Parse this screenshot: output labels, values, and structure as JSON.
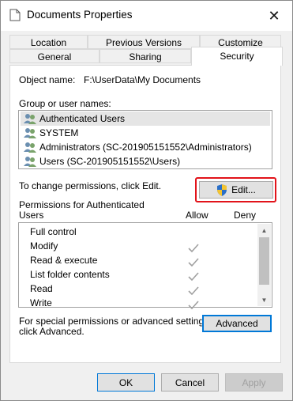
{
  "window": {
    "title": "Documents Properties",
    "close_glyph": "✕"
  },
  "tabs_top": [
    {
      "label": "Location"
    },
    {
      "label": "Previous Versions"
    },
    {
      "label": "Customize"
    }
  ],
  "tabs_bottom": [
    {
      "label": "General"
    },
    {
      "label": "Sharing"
    },
    {
      "label": "Security",
      "active": true
    }
  ],
  "security": {
    "object_label": "Object name:",
    "object_value": "F:\\UserData\\My Documents",
    "group_label": "Group or user names:",
    "users": [
      {
        "name": "Authenticated Users",
        "selected": true
      },
      {
        "name": "SYSTEM"
      },
      {
        "name": "Administrators (SC-201905151552\\Administrators)"
      },
      {
        "name": "Users (SC-201905151552\\Users)"
      }
    ],
    "change_text": "To change permissions, click Edit.",
    "edit_button": "Edit...",
    "perm_label_line1": "Permissions for Authenticated",
    "perm_label_line2": "Users",
    "allow_header": "Allow",
    "deny_header": "Deny",
    "permissions": [
      {
        "name": "Full control",
        "allow": false,
        "deny": false
      },
      {
        "name": "Modify",
        "allow": true,
        "deny": false
      },
      {
        "name": "Read & execute",
        "allow": true,
        "deny": false
      },
      {
        "name": "List folder contents",
        "allow": true,
        "deny": false
      },
      {
        "name": "Read",
        "allow": true,
        "deny": false
      },
      {
        "name": "Write",
        "allow": true,
        "deny": false
      }
    ],
    "advanced_text_line1": "For special permissions or advanced settings,",
    "advanced_text_line2": "click Advanced.",
    "advanced_button": "Advanced"
  },
  "footer": {
    "ok": "OK",
    "cancel": "Cancel",
    "apply": "Apply"
  },
  "colors": {
    "highlight": "#e2131a",
    "focus": "#0078d7"
  }
}
